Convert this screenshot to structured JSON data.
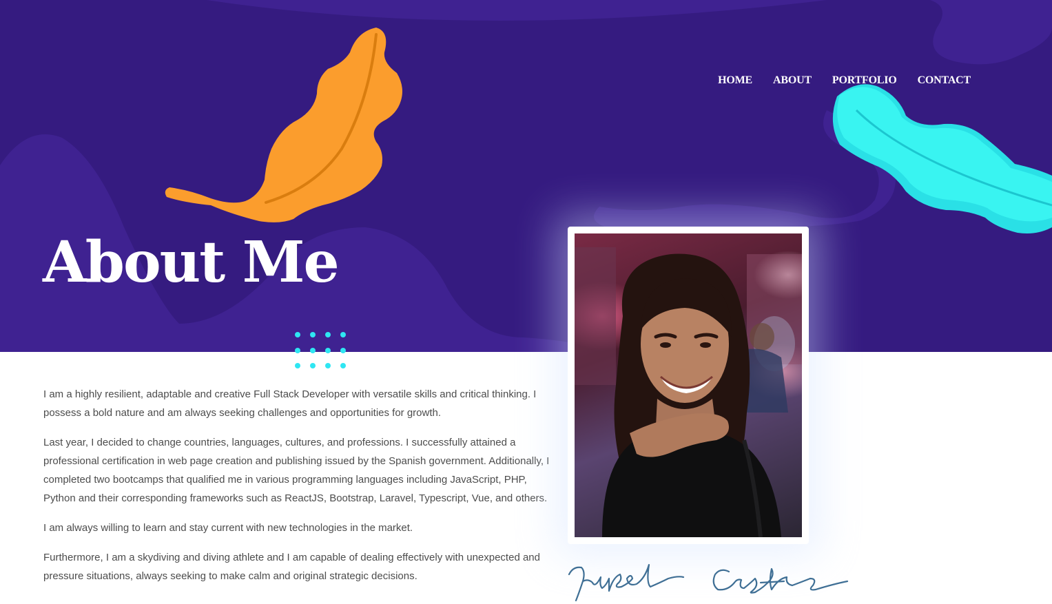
{
  "nav": {
    "items": [
      {
        "label": "HOME"
      },
      {
        "label": "ABOUT"
      },
      {
        "label": "PORTFOLIO"
      },
      {
        "label": "CONTACT"
      }
    ]
  },
  "hero": {
    "title": "About Me"
  },
  "bio": {
    "paragraphs": [
      "I am a highly resilient, adaptable and creative Full Stack Developer with versatile skills and critical thinking. I possess a bold nature and am always seeking challenges and opportunities for growth.",
      "Last year, I decided to change countries, languages, cultures, and professions. I successfully attained a professional certification in web page creation and publishing issued by the Spanish government. Additionally, I completed two bootcamps that qualified me in various programming languages including JavaScript, PHP, Python and their corresponding frameworks such as ReactJS, Bootstrap, Laravel, Typescript, Vue, and others.",
      "I am always willing to learn and stay current with new technologies in the market.",
      "Furthermore, I am a skydiving and diving athlete and I am capable of dealing effectively with unexpected and pressure situations, always seeking to make calm and original strategic decisions."
    ]
  },
  "signature": {
    "text": "Izabel Castro"
  },
  "icons": {
    "left_leaf": "orange-leaf-icon",
    "right_leaf": "cyan-leaf-icon",
    "dots": "dot-grid-decoration"
  },
  "colors": {
    "hero_background": "#351b80",
    "hero_shape": "#3f2291",
    "orange_leaf": "#fb9d2d",
    "cyan_leaf": "#34f1ef",
    "dot_color": "#2fe6f2",
    "signature_ink": "#3f6f95",
    "body_text": "#4c4c4c"
  }
}
